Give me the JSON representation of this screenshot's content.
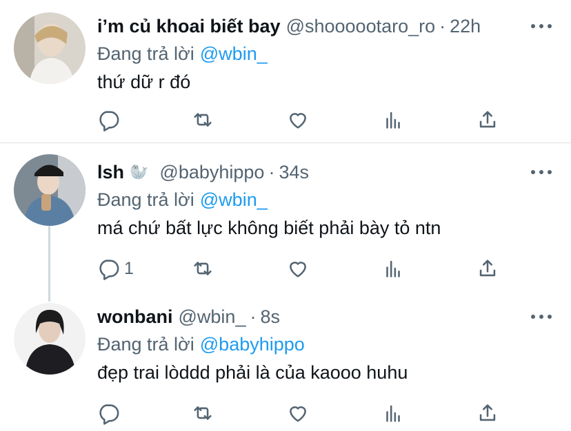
{
  "replying_prefix": "Đang trả lời",
  "colors": {
    "link": "#1d9bf0",
    "secondary": "#536471",
    "text": "#0f1419"
  },
  "icons": [
    "reply-icon",
    "retweet-icon",
    "like-icon",
    "analytics-icon",
    "share-icon",
    "more-icon"
  ],
  "tweets": [
    {
      "name": "i’m củ khoai biết bay",
      "emoji": "",
      "handle": "@shoooootaro_ro",
      "time": "22h",
      "replying_to": "@wbin_",
      "text": "thứ dữ r đó",
      "reply_count": ""
    },
    {
      "name": "lsh",
      "emoji": "🦭",
      "handle": "@babyhippo",
      "time": "34s",
      "replying_to": "@wbin_",
      "text": "má chứ bất lực không biết phải bày tỏ ntn",
      "reply_count": "1"
    },
    {
      "name": "wonbani",
      "emoji": "",
      "handle": "@wbin_",
      "time": "8s",
      "replying_to": "@babyhippo",
      "text": "đẹp trai lòddd phải là của kaooo huhu",
      "reply_count": ""
    }
  ]
}
